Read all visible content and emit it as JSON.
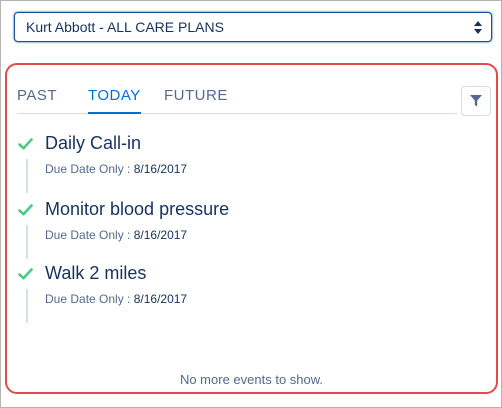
{
  "patient_select": {
    "value": "Kurt Abbott - ALL CARE PLANS"
  },
  "tabs": [
    {
      "label": "PAST",
      "active": false
    },
    {
      "label": "TODAY",
      "active": true
    },
    {
      "label": "FUTURE",
      "active": false
    }
  ],
  "filter_icon": "filter-icon",
  "events": [
    {
      "title": "Daily Call-in",
      "due_label": "Due Date Only : ",
      "due_date": "8/16/2017",
      "status_icon": "check-icon"
    },
    {
      "title": "Monitor blood pressure",
      "due_label": "Due Date Only : ",
      "due_date": "8/16/2017",
      "status_icon": "check-icon"
    },
    {
      "title": "Walk 2 miles",
      "due_label": "Due Date Only : ",
      "due_date": "8/16/2017",
      "status_icon": "check-icon"
    }
  ],
  "footer_text": "No more events to show.",
  "colors": {
    "accent": "#0070d2",
    "check": "#4bca81",
    "highlight_border": "#e04b4b",
    "title": "#16325c"
  }
}
